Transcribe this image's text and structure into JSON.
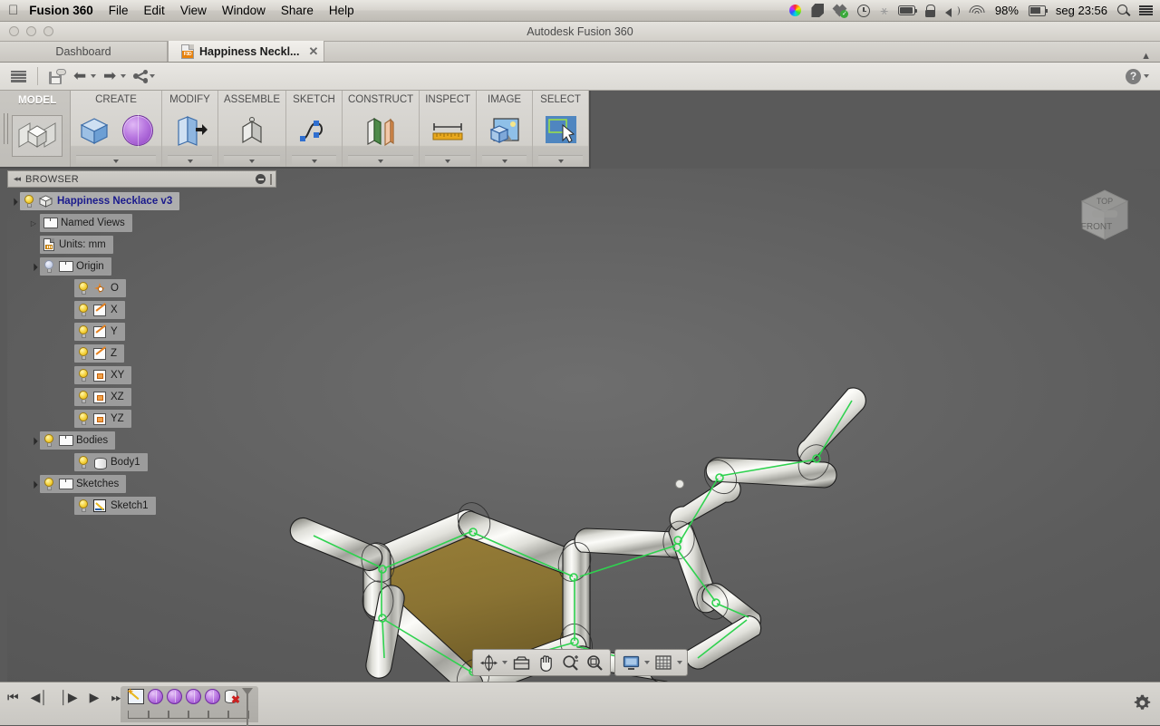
{
  "menubar": {
    "apple_icon": "apple-logo",
    "app_name": "Fusion 360",
    "items": [
      "File",
      "Edit",
      "View",
      "Window",
      "Share",
      "Help"
    ],
    "status": {
      "battery_percent": "98%",
      "clock": "seg 23:56",
      "icons": [
        "color-wheel-icon",
        "evernote-icon",
        "dropbox-icon",
        "timemachine-icon",
        "bluetooth-icon",
        "battery-icon",
        "lock-icon",
        "volume-icon",
        "wifi-icon",
        "power-adapter-icon",
        "spotlight-search-icon",
        "notification-center-icon"
      ]
    }
  },
  "window": {
    "title": "Autodesk Fusion 360",
    "traffic_lights": [
      "close",
      "minimize",
      "zoom"
    ]
  },
  "tabs": {
    "items": [
      {
        "label": "Dashboard",
        "active": false,
        "closable": false
      },
      {
        "label": "Happiness Neckl...",
        "active": true,
        "closable": true,
        "icon": "f3d-file-icon"
      }
    ],
    "collapse_icon": "chevron-up-icon"
  },
  "toolbar": {
    "menu_icon": "hamburger-menu-icon",
    "save_icon": "save-to-cloud-icon",
    "undo_icon": "undo-arrow-icon",
    "redo_icon": "redo-arrow-icon",
    "share_icon": "share-nodes-icon",
    "help_icon": "help-question-icon"
  },
  "ribbon": {
    "workspace": {
      "label": "MODEL",
      "icon": "model-cube-icon"
    },
    "panels": [
      {
        "title": "CREATE",
        "tools": [
          "box-primitive-icon",
          "sphere-primitive-icon"
        ]
      },
      {
        "title": "MODIFY",
        "tools": [
          "press-pull-icon"
        ]
      },
      {
        "title": "ASSEMBLE",
        "tools": [
          "joint-icon"
        ]
      },
      {
        "title": "SKETCH",
        "tools": [
          "spline-curve-icon"
        ]
      },
      {
        "title": "CONSTRUCT",
        "tools": [
          "offset-plane-icon"
        ]
      },
      {
        "title": "INSPECT",
        "tools": [
          "measure-ruler-icon"
        ]
      },
      {
        "title": "IMAGE",
        "tools": [
          "canvas-image-icon"
        ]
      },
      {
        "title": "SELECT",
        "tools": [
          "select-window-icon"
        ]
      }
    ]
  },
  "browser": {
    "title": "BROWSER",
    "collapse_icon": "double-chevron-left-icon",
    "minimize_icon": "minimize-circle-icon",
    "tree": [
      {
        "label": "Happiness Necklace v3",
        "icon": "component-cube-icon",
        "indent": 0,
        "arrow": "down",
        "bulb": true,
        "root": true
      },
      {
        "label": "Named Views",
        "icon": "folder-icon",
        "indent": 1,
        "arrow": "right",
        "bulb": false
      },
      {
        "label": "Units: mm",
        "icon": "units-document-icon",
        "indent": 1,
        "arrow": "none",
        "bulb": false
      },
      {
        "label": "Origin",
        "icon": "folder-icon",
        "indent": 1,
        "arrow": "down",
        "bulb": true,
        "bulb_off": true
      },
      {
        "label": "O",
        "icon": "origin-point-icon",
        "indent": 2,
        "arrow": "none",
        "bulb": true
      },
      {
        "label": "X",
        "icon": "axis-icon",
        "indent": 2,
        "arrow": "none",
        "bulb": true
      },
      {
        "label": "Y",
        "icon": "axis-icon",
        "indent": 2,
        "arrow": "none",
        "bulb": true
      },
      {
        "label": "Z",
        "icon": "axis-icon",
        "indent": 2,
        "arrow": "none",
        "bulb": true
      },
      {
        "label": "XY",
        "icon": "plane-icon",
        "indent": 2,
        "arrow": "none",
        "bulb": true
      },
      {
        "label": "XZ",
        "icon": "plane-icon",
        "indent": 2,
        "arrow": "none",
        "bulb": true
      },
      {
        "label": "YZ",
        "icon": "plane-icon",
        "indent": 2,
        "arrow": "none",
        "bulb": true
      },
      {
        "label": "Bodies",
        "icon": "folder-icon",
        "indent": 1,
        "arrow": "down",
        "bulb": true
      },
      {
        "label": "Body1",
        "icon": "body-icon",
        "indent": 2,
        "arrow": "none",
        "bulb": true
      },
      {
        "label": "Sketches",
        "icon": "folder-icon",
        "indent": 1,
        "arrow": "down",
        "bulb": true
      },
      {
        "label": "Sketch1",
        "icon": "sketch-icon",
        "indent": 2,
        "arrow": "none",
        "bulb": true
      }
    ]
  },
  "viewport": {
    "viewcube": {
      "top_face": "TOP",
      "front_face": "FRONT"
    },
    "navbar": {
      "tools": [
        "orbit-icon",
        "look-at-icon",
        "pan-hand-icon",
        "zoom-magnifier-icon",
        "fit-view-icon"
      ],
      "display": [
        "display-settings-icon",
        "grid-snap-icon"
      ]
    },
    "model_colors": {
      "chrome_light": "#f2f2ee",
      "chrome_mid": "#b8b8b2",
      "chrome_dark": "#6a6a66",
      "face_fill": "#8a7333",
      "sketch_line": "#2fd24f",
      "edge": "#1d1d1d",
      "background_center": "#6e6e6e",
      "background_edge": "#4e4e4e"
    }
  },
  "timeline": {
    "playback": [
      "skip-start-icon",
      "step-back-icon",
      "step-forward-icon",
      "play-icon",
      "skip-end-icon"
    ],
    "features": [
      "sketch-feature-icon",
      "sphere-feature-icon",
      "sphere-feature-icon",
      "sphere-feature-icon",
      "sphere-feature-icon",
      "delete-body-feature-icon"
    ],
    "settings_icon": "timeline-settings-gear-icon"
  }
}
